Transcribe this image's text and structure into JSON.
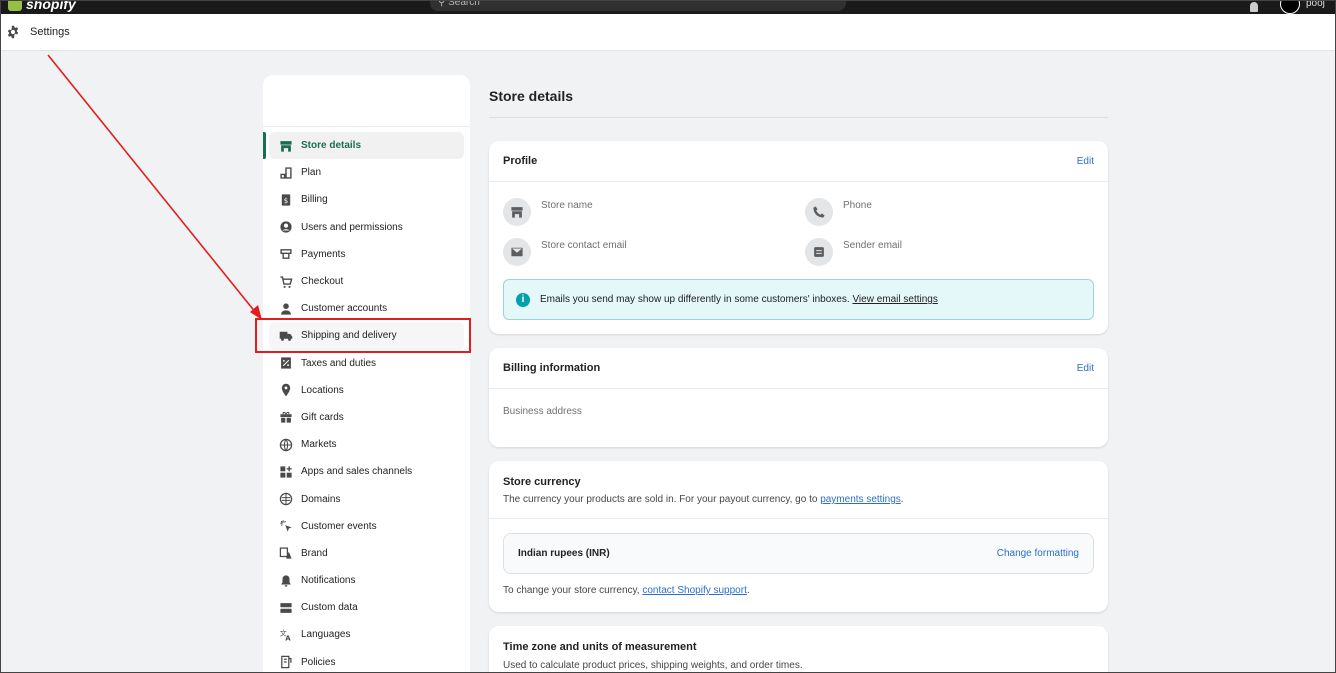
{
  "topbar": {
    "logo_text": "shopify",
    "search_placeholder": "Search",
    "user_name": "pooj"
  },
  "settings_header": {
    "title": "Settings",
    "icon": "gear-icon"
  },
  "nav": {
    "items": [
      {
        "label": "Store details",
        "icon": "store-icon",
        "active": true
      },
      {
        "label": "Plan",
        "icon": "plan-icon"
      },
      {
        "label": "Billing",
        "icon": "billing-icon"
      },
      {
        "label": "Users and permissions",
        "icon": "user-circle-icon"
      },
      {
        "label": "Payments",
        "icon": "payments-icon"
      },
      {
        "label": "Checkout",
        "icon": "cart-icon"
      },
      {
        "label": "Customer accounts",
        "icon": "person-icon"
      },
      {
        "label": "Shipping and delivery",
        "icon": "truck-icon",
        "highlighted": true
      },
      {
        "label": "Taxes and duties",
        "icon": "tax-icon"
      },
      {
        "label": "Locations",
        "icon": "location-pin-icon"
      },
      {
        "label": "Gift cards",
        "icon": "gift-icon"
      },
      {
        "label": "Markets",
        "icon": "globe-icon"
      },
      {
        "label": "Apps and sales channels",
        "icon": "apps-icon"
      },
      {
        "label": "Domains",
        "icon": "domain-globe-icon"
      },
      {
        "label": "Customer events",
        "icon": "cursor-sparkle-icon"
      },
      {
        "label": "Brand",
        "icon": "brand-icon"
      },
      {
        "label": "Notifications",
        "icon": "bell-icon"
      },
      {
        "label": "Custom data",
        "icon": "database-icon"
      },
      {
        "label": "Languages",
        "icon": "translate-icon"
      },
      {
        "label": "Policies",
        "icon": "policy-icon"
      }
    ]
  },
  "main": {
    "page_title": "Store details",
    "profile": {
      "title": "Profile",
      "edit_label": "Edit",
      "store_name_label": "Store name",
      "phone_label": "Phone",
      "contact_email_label": "Store contact email",
      "sender_email_label": "Sender email",
      "banner_text": "Emails you send may show up differently in some customers' inboxes.",
      "banner_link": "View email settings"
    },
    "billing": {
      "title": "Billing information",
      "edit_label": "Edit",
      "address_label": "Business address"
    },
    "currency": {
      "title": "Store currency",
      "desc_prefix": "The currency your products are sold in. For your payout currency, go to",
      "desc_link": "payments settings",
      "desc_suffix": ".",
      "currency_value": "Indian rupees (INR)",
      "change_label": "Change formatting",
      "footer_prefix": "To change your store currency,",
      "footer_link": "contact Shopify support",
      "footer_suffix": "."
    },
    "timezone": {
      "title": "Time zone and units of measurement",
      "desc": "Used to calculate product prices, shipping weights, and order times."
    }
  },
  "colors": {
    "accent_green": "#1b6e54",
    "link_blue": "#2c6ecb",
    "annotation_red": "#e11d1d",
    "banner_bg": "#e4f7f9"
  }
}
